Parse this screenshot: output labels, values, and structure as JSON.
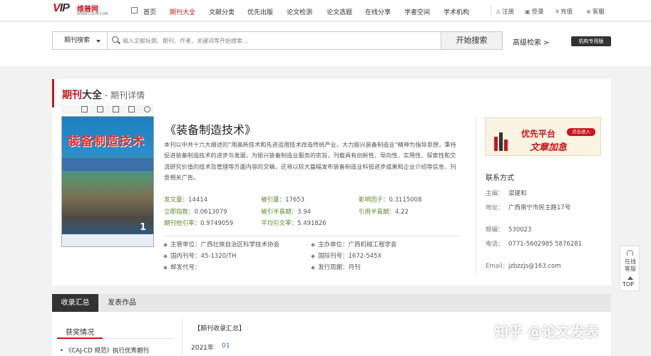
{
  "header": {
    "logo": {
      "mark_v": "V",
      "mark_rest": "IP",
      "name": "维普网",
      "url": "WWW.CQVIP.COM"
    },
    "nav": [
      "首页",
      "期刊大全",
      "文献分类",
      "优先出版",
      "论文检测",
      "论文选题",
      "在线分享",
      "学者空间",
      "学术机构"
    ],
    "active_nav": "期刊大全",
    "utils": [
      {
        "glyph": "♙",
        "label": "注册"
      },
      {
        "glyph": "▣",
        "label": "登录"
      },
      {
        "glyph": "¥",
        "label": "充值"
      },
      {
        "glyph": "⊕",
        "label": "客服"
      }
    ]
  },
  "search": {
    "type_label": "期刊搜索",
    "placeholder": "输入文献标题、期刊、作者、关键词等开始搜索...",
    "button": "开始搜索",
    "advanced": "高级检索 >",
    "institution": "机构专用版"
  },
  "page": {
    "head_a": "期刊",
    "head_b": "大全",
    "head_c": " - 期刊详情"
  },
  "cover": {
    "title": "装备制造技术",
    "issue": "1"
  },
  "journal": {
    "title": "《装备制造技术》",
    "description": "本刊以中共十六大阐述的“用高新技术和先进适用技术改造传统产业，大力振兴装备制造业”精神为指导思想，秉持促进装备制造技术的进步与发展，为振兴装备制造业服务的宗旨，刊载具有创新性、导向性、实用性、探索性和交流研究价值的技术及管理等方面内容的文稿，还将以较大篇幅发布装备制造业科技进步成果和企业介绍等信息，刊登相关广告。",
    "stats": [
      {
        "key": "发文量：",
        "value": "14414"
      },
      {
        "key": "被引量：",
        "value": "17653"
      },
      {
        "key": "影响因子：",
        "value": "0.3115008"
      },
      {
        "key": "立即指数：",
        "value": "0.0613079"
      },
      {
        "key": "被引半衰期：",
        "value": "3.94"
      },
      {
        "key": "引用半衰期：",
        "value": "4.22"
      },
      {
        "key": "期刊他引率：",
        "value": "0.9749059"
      },
      {
        "key": "平均引文率：",
        "value": "5.491826"
      }
    ],
    "meta": [
      {
        "key": "主管单位：",
        "value": "广西壮族自治区科学技术协会"
      },
      {
        "key": "主办单位：",
        "value": "广西机械工程学会"
      },
      {
        "key": "国内刊号：",
        "value": "45-1320/TH"
      },
      {
        "key": "国际刊号：",
        "value": "1672-545X"
      },
      {
        "key": "邮发代号：",
        "value": ""
      },
      {
        "key": "发行周期：",
        "value": "月刊"
      }
    ]
  },
  "promo": {
    "line1": "优先平台",
    "line2": "文章加急",
    "tag": "点击进入"
  },
  "contact": {
    "heading": "联系方式",
    "items": [
      {
        "key": "主编：",
        "value": "梁建和"
      },
      {
        "key": "地址：",
        "value": "广西南宁市民主路17号"
      },
      {
        "key": "邮编：",
        "value": "530023"
      },
      {
        "key": "电话：",
        "value": "0771-5602985 5876281"
      },
      {
        "key": "Email：",
        "value": "jzbzzjs@163.com"
      }
    ]
  },
  "side": {
    "service": "在线客服",
    "top": "TOP"
  },
  "tabs": [
    "收录汇总",
    "发表作品"
  ],
  "lower": {
    "award_heading": "获奖情况",
    "award_item": "• 《CAJ-CD 规范》执行优秀期刊",
    "collect_heading": "【期刊收录汇总】",
    "year": "2021年",
    "issue": "01"
  },
  "watermark": "知乎 @论文发表"
}
